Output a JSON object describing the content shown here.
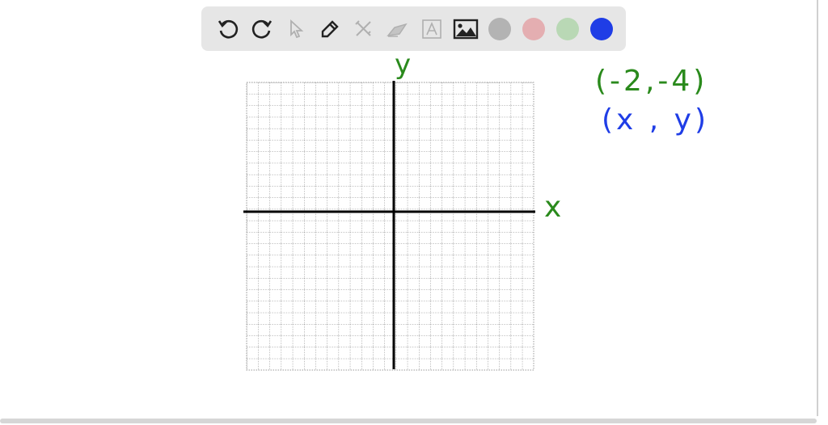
{
  "toolbar": {
    "tools": [
      "undo-icon",
      "redo-icon",
      "select-icon",
      "pen-icon",
      "tools-icon",
      "eraser-icon",
      "text-icon",
      "image-icon"
    ],
    "colors": [
      "#b3b3b3",
      "#e4aeb1",
      "#b9d8b5",
      "#1f3de6"
    ]
  },
  "graph": {
    "x_label": "x",
    "y_label": "y",
    "axis_color": "#000000",
    "label_color": "#2a8a1c"
  },
  "notes": {
    "point": "(-2,-4)",
    "point_color": "#2a8a1c",
    "form": "(x , y)",
    "form_color": "#1f3de6"
  }
}
